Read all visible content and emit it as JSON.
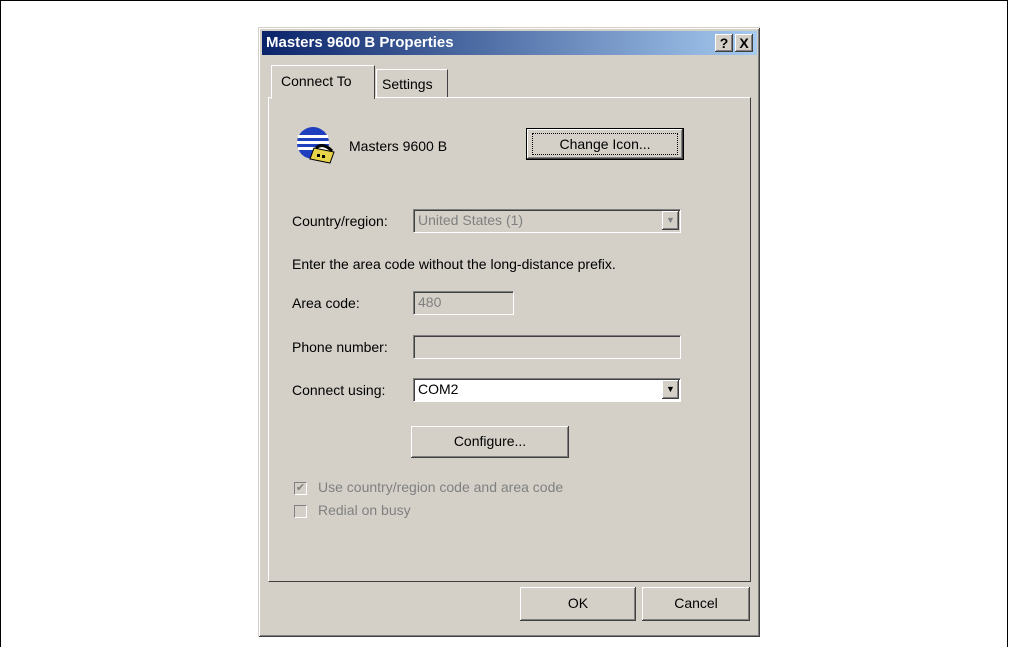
{
  "dialog": {
    "title": "Masters 9600 B Properties",
    "help_button": "?",
    "close_button": "X"
  },
  "tabs": [
    {
      "label": "Connect To"
    },
    {
      "label": "Settings"
    }
  ],
  "connection": {
    "name": "Masters 9600 B",
    "change_icon_label": "Change Icon..."
  },
  "form": {
    "country_label": "Country/region:",
    "country_value": "United States (1)",
    "instruction": "Enter the area code without the long-distance prefix.",
    "area_code_label": "Area code:",
    "area_code_value": "480",
    "phone_label": "Phone number:",
    "phone_value": "",
    "connect_using_label": "Connect using:",
    "connect_using_value": "COM2",
    "configure_label": "Configure...",
    "use_country_code_label": "Use country/region code and area code",
    "use_country_code_checked": true,
    "redial_label": "Redial on busy",
    "redial_checked": false
  },
  "footer": {
    "ok_label": "OK",
    "cancel_label": "Cancel"
  }
}
